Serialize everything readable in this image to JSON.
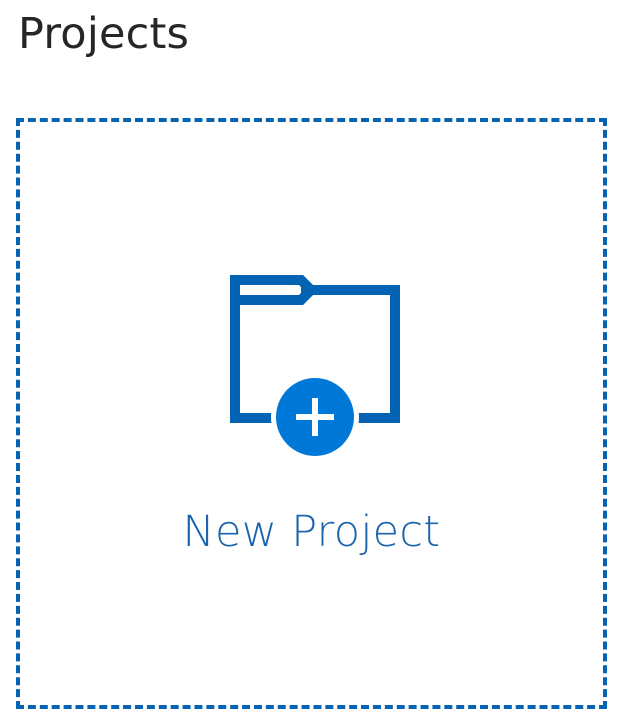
{
  "page": {
    "title": "Projects"
  },
  "tile": {
    "label": "New Project",
    "icon": "folder-add-icon"
  },
  "colors": {
    "accent": "#0563b4",
    "icon_badge": "#0078d7",
    "label": "#1a63ad",
    "title": "#262626"
  }
}
